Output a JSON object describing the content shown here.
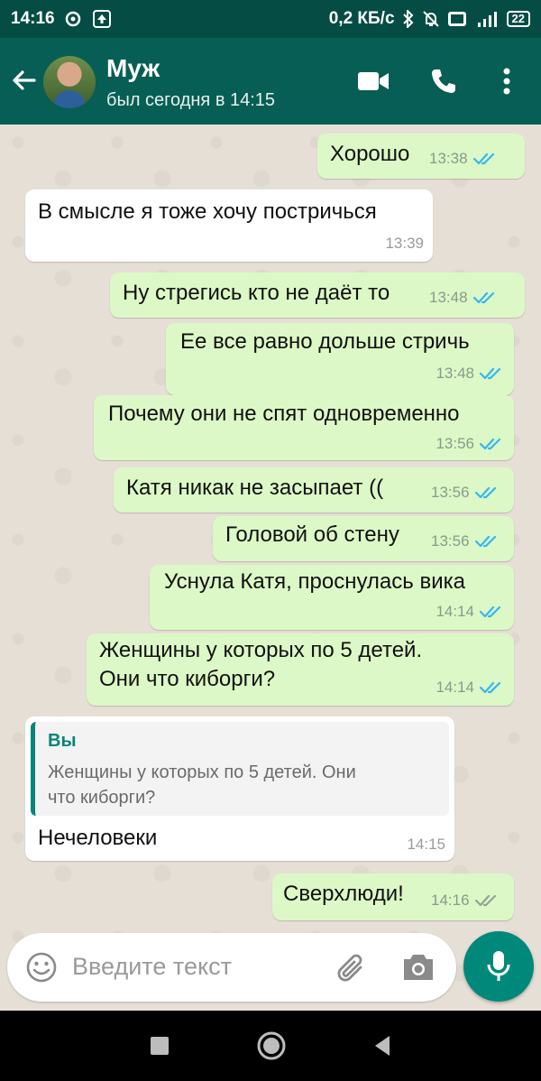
{
  "status_bar": {
    "time": "14:16",
    "speed": "0,2 КБ/с",
    "battery": "22"
  },
  "header": {
    "name": "Муж",
    "status": "был сегодня в 14:15"
  },
  "messages": [
    {
      "text": "Хорошо",
      "time": "13:38",
      "dir": "out",
      "read": true
    },
    {
      "text": "В смысле я тоже хочу постричься",
      "time": "13:39",
      "dir": "in"
    },
    {
      "text": "Ну стрегись кто не даёт то",
      "time": "13:48",
      "dir": "out",
      "read": true
    },
    {
      "text": "Ее все равно дольше стричь",
      "time": "13:48",
      "dir": "out",
      "read": true
    },
    {
      "text": "Почему они не спят одновременно",
      "time": "13:56",
      "dir": "out",
      "read": true
    },
    {
      "text": "Катя никак не засыпает ((",
      "time": "13:56",
      "dir": "out",
      "read": true
    },
    {
      "text": "Головой об стену",
      "time": "13:56",
      "dir": "out",
      "read": true
    },
    {
      "text": "Уснула Катя, проснулась вика",
      "time": "14:14",
      "dir": "out",
      "read": true
    },
    {
      "text_line1": "Женщины у которых по 5 детей.",
      "text_line2": "Они что киборги?",
      "time": "14:14",
      "dir": "out",
      "read": true
    },
    {
      "quote_author": "Вы",
      "quote_line1": "Женщины у которых по 5 детей. Они",
      "quote_line2": "что киборги?",
      "text": "Нечеловеки",
      "time": "14:15",
      "dir": "in"
    },
    {
      "text": "Сверхлюди!",
      "time": "14:16",
      "dir": "out",
      "read": false
    }
  ],
  "input": {
    "placeholder": "Введите текст"
  },
  "colors": {
    "header": "#075e54",
    "outgoing_bubble": "#dcf8c6",
    "incoming_bubble": "#ffffff",
    "read_ticks": "#34b7f1",
    "mic_button": "#00897b"
  },
  "icons": [
    "back-arrow-icon",
    "video-call-icon",
    "phone-icon",
    "more-vert-icon",
    "emoji-icon",
    "attach-icon",
    "camera-icon",
    "mic-icon"
  ]
}
